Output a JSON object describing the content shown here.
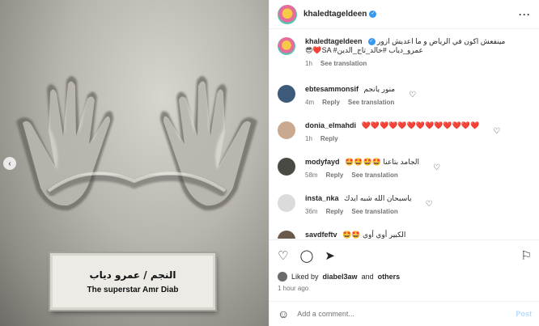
{
  "media": {
    "plaque_ar": "النجم / عمرو دياب",
    "plaque_en": "The superstar Amr Diab",
    "prev_icon": "chevron-left-icon"
  },
  "post": {
    "author": "khaledtageldeen",
    "caption_text": "مينفعش اكون في الرياض و ما اعديش ازور 😎❤️SA #عمرو_دياب #خالد_تاج_الدين",
    "caption_time": "1h",
    "see_translation": "See translation"
  },
  "comments": [
    {
      "user": "ebtesammonsif",
      "text": "منور يانجم",
      "time": "4m",
      "reply": "Reply",
      "translation": "See translation"
    },
    {
      "user": "donia_elmahdi",
      "text": "❤️❤️❤️❤️❤️❤️❤️❤️❤️❤️❤️❤️❤️",
      "time": "1h",
      "reply": "Reply",
      "translation": ""
    },
    {
      "user": "modyfayd",
      "text": "🤩🤩🤩🤩 الجامد بتاعنا",
      "time": "58m",
      "reply": "Reply",
      "translation": "See translation"
    },
    {
      "user": "insta_nka",
      "text": "ياسبحان الله شبه ايدك",
      "time": "36m",
      "reply": "Reply",
      "translation": "See translation"
    },
    {
      "user": "savdfeftv",
      "text": "🤩🤩 الكبير أوي أوي",
      "time": "",
      "reply": "",
      "translation": ""
    }
  ],
  "footer": {
    "liked_prefix": "Liked by",
    "liked_user": "diabel3aw",
    "liked_and": "and",
    "liked_others": "others",
    "ago": "1 hour ago",
    "add_placeholder": "Add a comment...",
    "post_label": "Post"
  }
}
